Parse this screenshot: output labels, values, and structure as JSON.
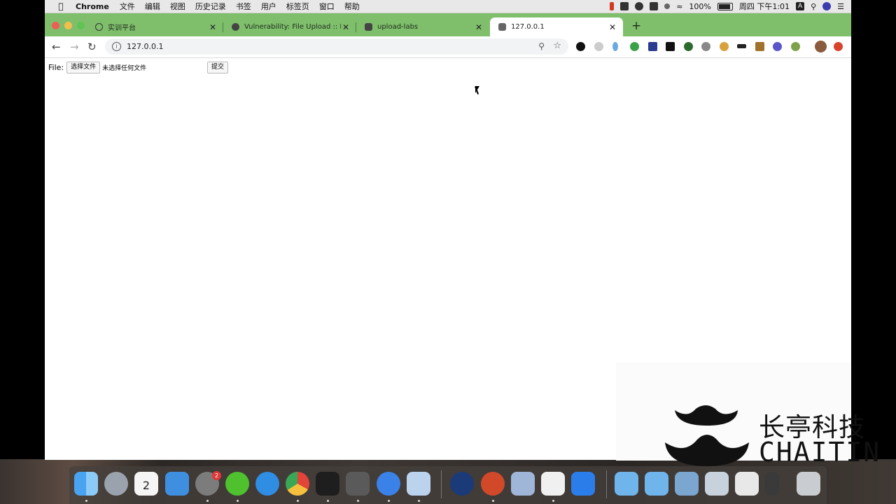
{
  "menubar": {
    "app": "Chrome",
    "items": [
      "文件",
      "编辑",
      "视图",
      "历史记录",
      "书签",
      "用户",
      "标签页",
      "窗口",
      "帮助"
    ],
    "battery": "100%",
    "datetime": "周四 下午1:01",
    "input_indicator": "A"
  },
  "tabs": [
    {
      "title": "实训平台"
    },
    {
      "title": "Vulnerability: File Upload :: Damn"
    },
    {
      "title": "upload-labs"
    },
    {
      "title": "127.0.0.1"
    }
  ],
  "address_bar": {
    "url": "127.0.0.1"
  },
  "form": {
    "label": "File:",
    "choose_button": "选择文件",
    "no_file_text": "未选择任何文件",
    "submit_button": "提交"
  },
  "watermark": {
    "cn": "长亭科技",
    "en": "CHAITIN"
  },
  "dock": {
    "calendar_day": "2",
    "settings_badge": "2"
  }
}
